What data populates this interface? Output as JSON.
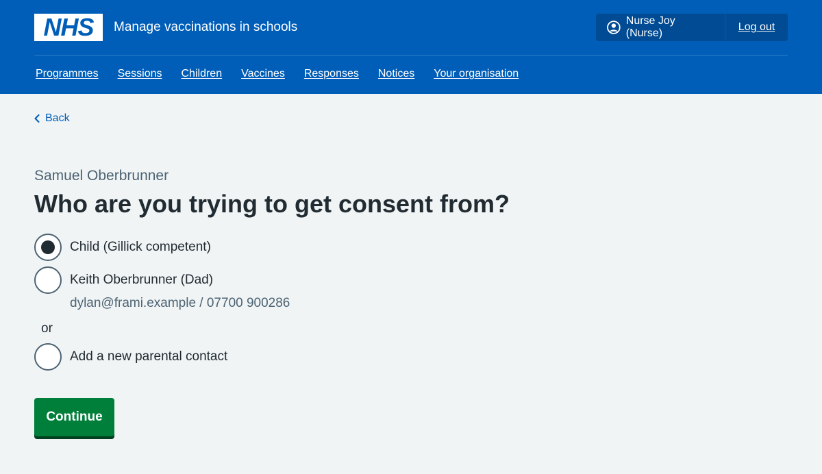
{
  "header": {
    "logo_text": "NHS",
    "service_name": "Manage vaccinations in schools",
    "user_name": "Nurse Joy (Nurse)",
    "logout_label": "Log out"
  },
  "nav": {
    "items": [
      "Programmes",
      "Sessions",
      "Children",
      "Vaccines",
      "Responses",
      "Notices",
      "Your organisation"
    ]
  },
  "back_label": "Back",
  "caption": "Samuel Oberbrunner",
  "heading": "Who are you trying to get consent from?",
  "options": [
    {
      "label": "Child (Gillick competent)",
      "selected": true
    },
    {
      "label": "Keith Oberbrunner (Dad)",
      "selected": false,
      "hint": "dylan@frami.example / 07700 900286"
    },
    {
      "label": "Add a new parental contact",
      "selected": false
    }
  ],
  "or_label": "or",
  "continue_label": "Continue",
  "colors": {
    "brand_blue": "#005eb8",
    "button_green": "#007f3b",
    "background": "#f0f4f5"
  }
}
